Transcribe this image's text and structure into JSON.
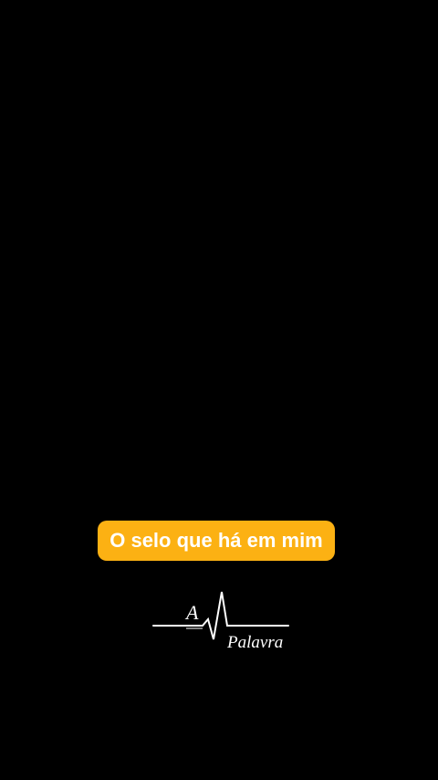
{
  "caption": {
    "text": "O selo que há em mim",
    "bg_color": "#fcb113",
    "text_color": "#ffffff"
  },
  "logo": {
    "icon": "heartbeat-line-icon",
    "article": "A",
    "word": "Palavra"
  },
  "background_color": "#000000"
}
